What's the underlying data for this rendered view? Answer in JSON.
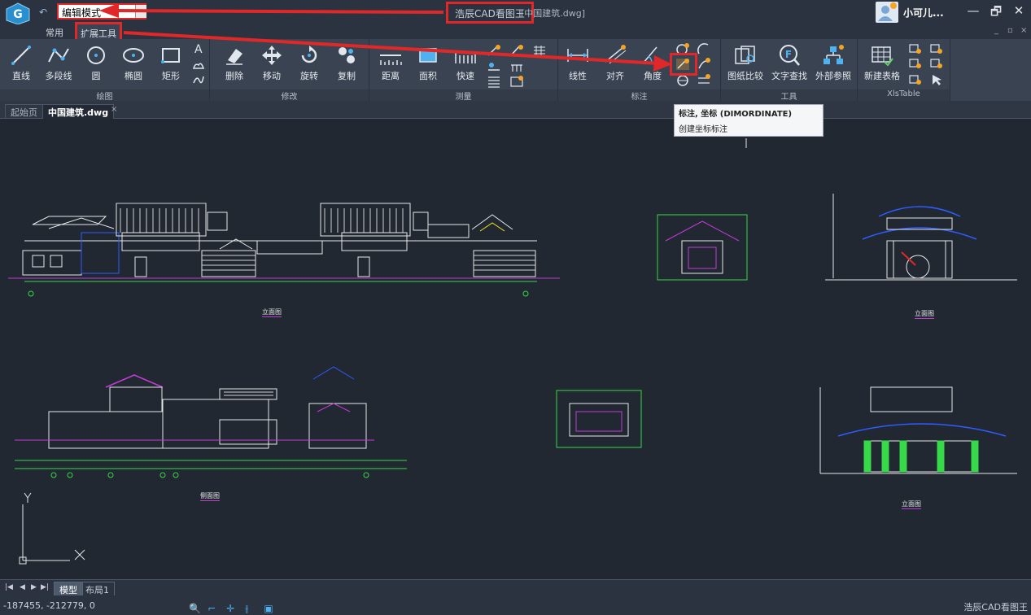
{
  "titlebar": {
    "mode": "编辑模式",
    "app_title": "浩辰CAD看图王",
    "file_title": "[中国建筑.dwg]",
    "user_name": "小可儿...",
    "minimize": "—",
    "restore": "🗗",
    "close": "✕",
    "undo": "↶"
  },
  "menu_tabs": [
    "常用",
    "扩展工具"
  ],
  "ribbon": {
    "groups": [
      {
        "label": "绘图",
        "buttons": [
          "直线",
          "多段线",
          "圆",
          "椭圆",
          "矩形"
        ]
      },
      {
        "label": "修改",
        "buttons": [
          "删除",
          "移动",
          "旋转",
          "复制"
        ]
      },
      {
        "label": "测量",
        "buttons": [
          "距离",
          "面积",
          "快速"
        ]
      },
      {
        "label": "标注",
        "buttons": [
          "线性",
          "对齐",
          "角度"
        ]
      },
      {
        "label": "工具",
        "buttons": [
          "图纸比较",
          "文字查找",
          "外部参照"
        ]
      },
      {
        "label": "XlsTable",
        "buttons": [
          "新建表格"
        ]
      }
    ]
  },
  "tooltip": {
    "title": "标注, 坐标 (DIMORDINATE)",
    "desc": "创建坐标标注"
  },
  "doc_tabs": [
    "起始页",
    "中国建筑.dwg"
  ],
  "drawing_labels": [
    "立面图",
    "立面图",
    "侧面图",
    "立面图"
  ],
  "layout_tabs": [
    "模型",
    "布局1"
  ],
  "status": {
    "coords": "-187455, -212779, 0",
    "app": "浩辰CAD看图王"
  },
  "colors": {
    "accent_red": "#e02828",
    "canvas": "#212832",
    "ribbon": "#3a4352"
  }
}
